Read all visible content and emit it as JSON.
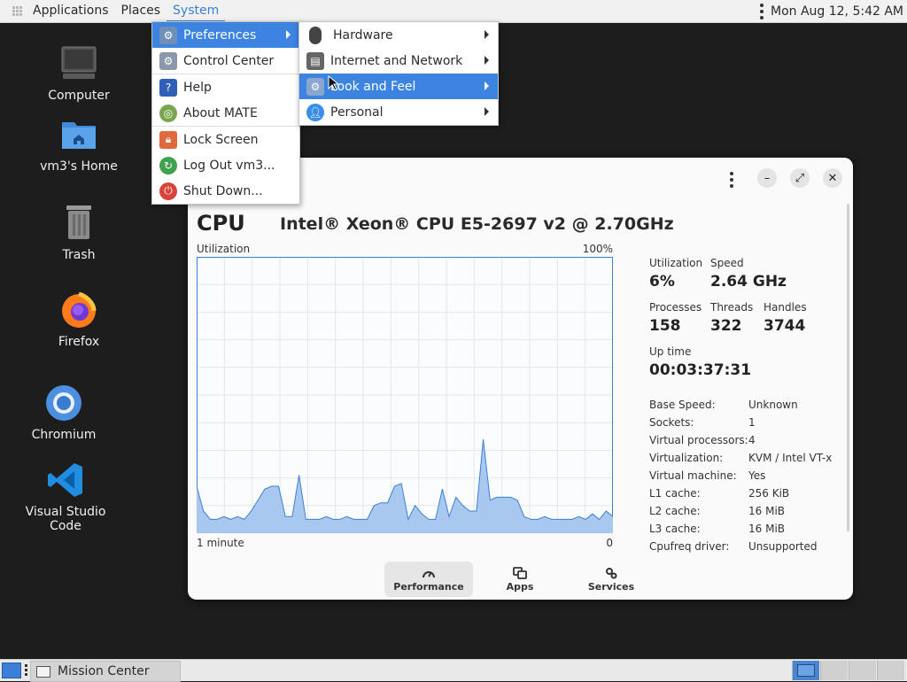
{
  "top_panel": {
    "menus": [
      "Applications",
      "Places",
      "System"
    ],
    "clock": "Mon Aug 12,  5:42 AM"
  },
  "desktop_icons": [
    {
      "label": "Computer",
      "icon": "computer-icon"
    },
    {
      "label": "vm3's Home",
      "icon": "home-folder-icon"
    },
    {
      "label": "Trash",
      "icon": "trash-icon"
    },
    {
      "label": "Firefox",
      "icon": "firefox-icon"
    },
    {
      "label": "Chromium",
      "icon": "chromium-icon"
    },
    {
      "label": "Visual Studio Code",
      "icon": "vscode-icon"
    }
  ],
  "system_menu": {
    "items": [
      {
        "label": "Preferences",
        "icon": "preferences-icon",
        "submenu": true,
        "selected": true
      },
      {
        "label": "Control Center",
        "icon": "control-center-icon"
      },
      {
        "label": "Help",
        "icon": "help-icon"
      },
      {
        "label": "About MATE",
        "icon": "mate-icon"
      },
      {
        "label": "Lock Screen",
        "icon": "lock-icon"
      },
      {
        "label": "Log Out vm3...",
        "icon": "logout-icon"
      },
      {
        "label": "Shut Down...",
        "icon": "power-icon"
      }
    ]
  },
  "preferences_menu": {
    "items": [
      {
        "label": "Hardware",
        "icon": "mouse-icon"
      },
      {
        "label": "Internet and Network",
        "icon": "network-icon"
      },
      {
        "label": "Look and Feel",
        "icon": "look-and-feel-icon",
        "selected": true
      },
      {
        "label": "Personal",
        "icon": "person-icon"
      }
    ]
  },
  "mission_center": {
    "title": "CPU",
    "model": "Intel® Xeon® CPU E5-2697 v2 @ 2.70GHz",
    "graph": {
      "label": "Utilization",
      "max_label": "100%",
      "time_label": "1 minute",
      "min_label": "0",
      "color_line": "#3b7fd6",
      "color_fill": "#a9c8ef",
      "points": [
        17,
        8,
        5,
        5,
        6,
        5,
        6,
        5,
        8,
        12,
        16,
        17,
        17,
        6,
        6,
        21,
        5,
        5,
        5,
        6,
        5,
        5,
        6,
        5,
        5,
        5,
        10,
        11,
        11,
        17,
        18,
        5,
        10,
        7,
        5,
        5,
        16,
        6,
        13,
        10,
        8,
        8,
        34,
        12,
        13,
        13,
        13,
        12,
        6,
        5,
        5,
        6,
        5,
        5,
        5,
        5,
        6,
        5,
        7,
        5,
        8,
        6
      ]
    },
    "stats": {
      "utilization_label": "Utilization",
      "utilization": "6%",
      "speed_label": "Speed",
      "speed": "2.64 GHz",
      "processes_label": "Processes",
      "processes": "158",
      "threads_label": "Threads",
      "threads": "322",
      "handles_label": "Handles",
      "handles": "3744",
      "uptime_label": "Up time",
      "uptime": "00:03:37:31"
    },
    "specs": [
      {
        "label": "Base Speed:",
        "value": "Unknown"
      },
      {
        "label": "Sockets:",
        "value": "1"
      },
      {
        "label": "Virtual processors:",
        "value": "4"
      },
      {
        "label": "Virtualization:",
        "value": "KVM / Intel VT-x"
      },
      {
        "label": "Virtual machine:",
        "value": "Yes"
      },
      {
        "label": "L1 cache:",
        "value": "256 KiB"
      },
      {
        "label": "L2 cache:",
        "value": "16 MiB"
      },
      {
        "label": "L3 cache:",
        "value": "16 MiB"
      },
      {
        "label": "Cpufreq driver:",
        "value": "Unsupported"
      }
    ],
    "tabs": [
      {
        "label": "Performance",
        "icon": "gauge-icon",
        "active": true
      },
      {
        "label": "Apps",
        "icon": "apps-icon"
      },
      {
        "label": "Services",
        "icon": "gears-icon"
      }
    ]
  },
  "bottom_panel": {
    "task_label": "Mission Center"
  }
}
